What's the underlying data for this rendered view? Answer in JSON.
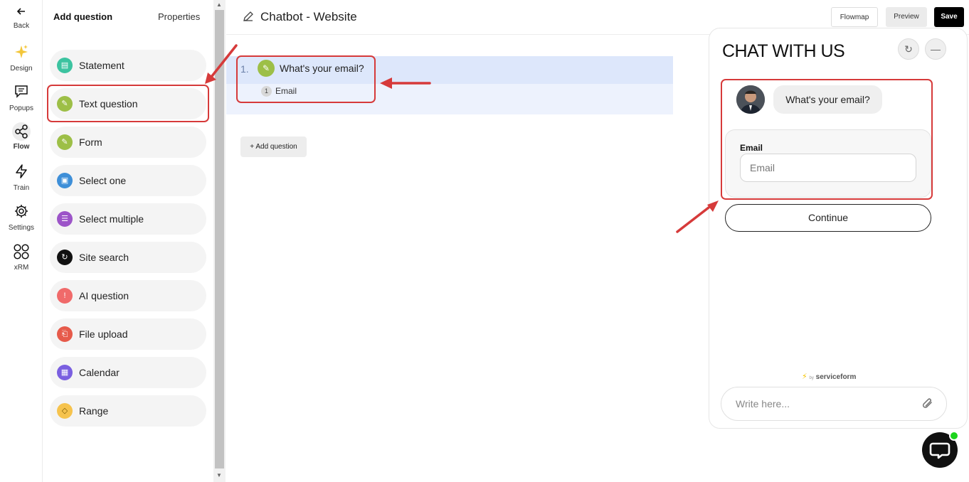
{
  "rail": {
    "back": "Back",
    "items": [
      {
        "label": "Design",
        "icon": "sparkle-icon"
      },
      {
        "label": "Popups",
        "icon": "message-icon"
      },
      {
        "label": "Flow",
        "icon": "share-icon"
      },
      {
        "label": "Train",
        "icon": "bolt-icon"
      },
      {
        "label": "Settings",
        "icon": "gear-icon"
      },
      {
        "label": "xRM",
        "icon": "grid-icon"
      }
    ]
  },
  "panel": {
    "tab_add": "Add question",
    "tab_properties": "Properties",
    "question_types": [
      {
        "label": "Statement",
        "color": "#3cc3a0"
      },
      {
        "label": "Text question",
        "color": "#9dbf47"
      },
      {
        "label": "Form",
        "color": "#9dbf47"
      },
      {
        "label": "Select one",
        "color": "#3e8fd8"
      },
      {
        "label": "Select multiple",
        "color": "#9c54c8"
      },
      {
        "label": "Site search",
        "color": "#111111"
      },
      {
        "label": "AI question",
        "color": "#f06a6a"
      },
      {
        "label": "File upload",
        "color": "#e65a4a"
      },
      {
        "label": "Calendar",
        "color": "#7a5fe0"
      },
      {
        "label": "Range",
        "color": "#f6c34d"
      }
    ]
  },
  "topbar": {
    "title": "Chatbot - Website",
    "flowmap": "Flowmap",
    "preview": "Preview",
    "save": "Save"
  },
  "canvas": {
    "question_number": "1.",
    "question_text": "What's your email?",
    "field_badge": "1",
    "field_label": "Email",
    "add_question": "+ Add question"
  },
  "chat": {
    "title": "CHAT WITH US",
    "bubble": "What's your email?",
    "form_label": "Email",
    "form_placeholder": "Email",
    "continue": "Continue",
    "powered_by": "by",
    "brand": "serviceform",
    "write_placeholder": "Write here..."
  },
  "colors": {
    "annotation_red": "#d63a3a",
    "online": "#1cd41c"
  }
}
